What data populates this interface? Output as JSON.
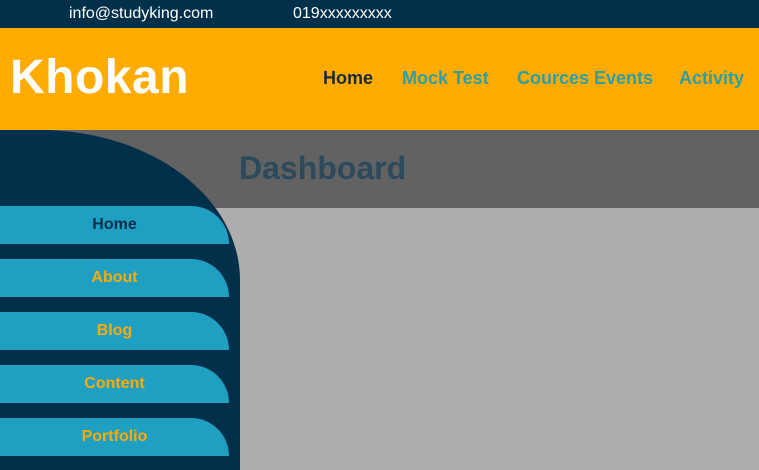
{
  "topbar": {
    "email": "info@studyking.com",
    "phone": "019xxxxxxxxx"
  },
  "header": {
    "brand": "Khokan",
    "nav": [
      {
        "label": "Home",
        "active": true
      },
      {
        "label": "Mock Test",
        "active": false
      },
      {
        "label": "Cources Events",
        "active": false
      },
      {
        "label": "Activity",
        "active": false
      }
    ]
  },
  "banner": {
    "title": "Dashboard"
  },
  "sidebar": {
    "items": [
      {
        "label": "Home",
        "active": true
      },
      {
        "label": "About",
        "active": false
      },
      {
        "label": "Blog",
        "active": false
      },
      {
        "label": "Content",
        "active": false
      },
      {
        "label": "Portfolio",
        "active": false
      }
    ]
  },
  "colors": {
    "topbar": "#02304b",
    "header": "#ffab00",
    "nav_link": "#2d9fa5",
    "nav_active": "#162c38",
    "banner": "#626262",
    "title": "#2c4a5c",
    "content": "#adadad",
    "sidebar": "#02304b",
    "sidebar_item": "#1f9fc2",
    "sidebar_label": "#ffab00",
    "sidebar_label_active": "#02304b"
  }
}
